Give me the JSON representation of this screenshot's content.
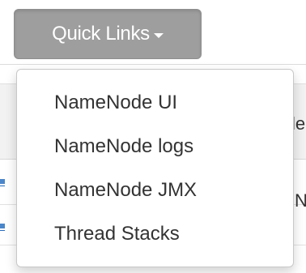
{
  "dropdown": {
    "button_label": "Quick Links",
    "caret_icon": "caret-down-icon",
    "items": [
      {
        "label": "NameNode UI"
      },
      {
        "label": "NameNode logs"
      },
      {
        "label": "NameNode JMX"
      },
      {
        "label": "Thread Stacks"
      }
    ]
  },
  "background": {
    "header_fragment": "le",
    "cell_fragment": "N"
  }
}
